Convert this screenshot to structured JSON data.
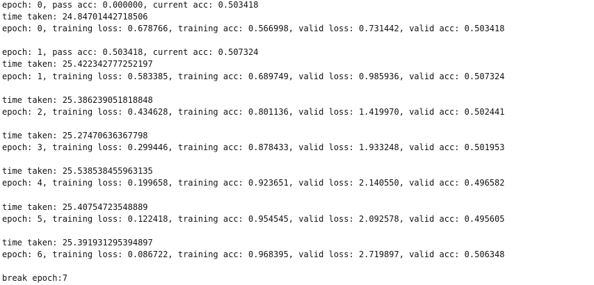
{
  "console": {
    "lines": [
      "epoch: 0, pass acc: 0.000000, current acc: 0.503418",
      "time taken: 24.84701442718506",
      "epoch: 0, training loss: 0.678766, training acc: 0.566998, valid loss: 0.731442, valid acc: 0.503418",
      "",
      "epoch: 1, pass acc: 0.503418, current acc: 0.507324",
      "time taken: 25.422342777252197",
      "epoch: 1, training loss: 0.583385, training acc: 0.689749, valid loss: 0.985936, valid acc: 0.507324",
      "",
      "time taken: 25.386239051818848",
      "epoch: 2, training loss: 0.434628, training acc: 0.801136, valid loss: 1.419970, valid acc: 0.502441",
      "",
      "time taken: 25.27470636367798",
      "epoch: 3, training loss: 0.299446, training acc: 0.878433, valid loss: 1.933248, valid acc: 0.501953",
      "",
      "time taken: 25.538538455963135",
      "epoch: 4, training loss: 0.199658, training acc: 0.923651, valid loss: 2.140550, valid acc: 0.496582",
      "",
      "time taken: 25.40754723548889",
      "epoch: 5, training loss: 0.122418, training acc: 0.954545, valid loss: 2.092578, valid acc: 0.495605",
      "",
      "time taken: 25.391931295394897",
      "epoch: 6, training loss: 0.086722, training acc: 0.968395, valid loss: 2.719897, valid acc: 0.506348",
      "",
      "break epoch:7"
    ]
  }
}
